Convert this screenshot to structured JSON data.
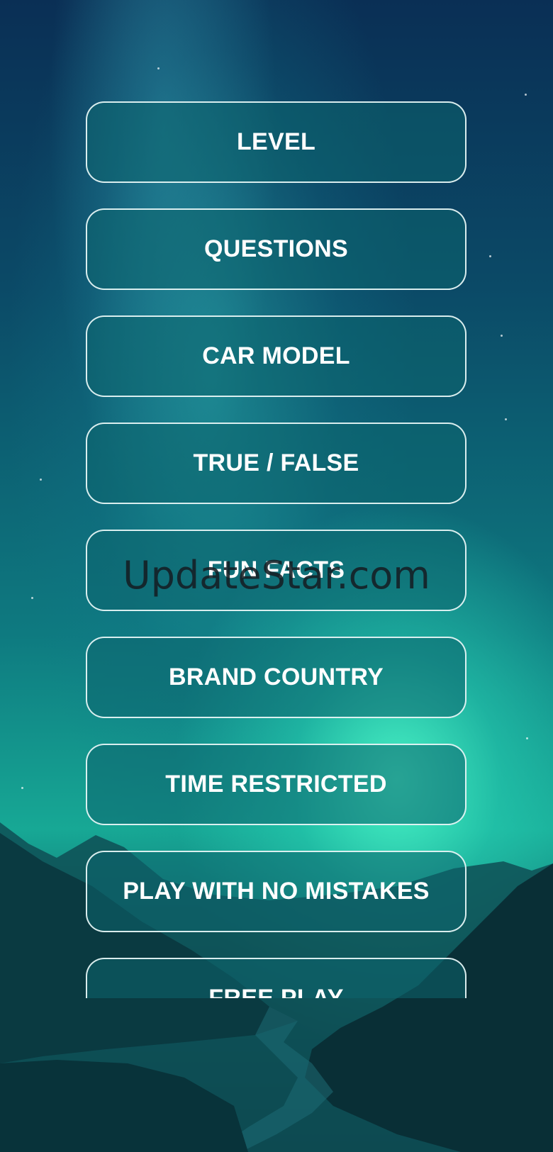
{
  "menu": {
    "items": [
      {
        "label": "LEVEL"
      },
      {
        "label": "QUESTIONS"
      },
      {
        "label": "CAR MODEL"
      },
      {
        "label": "TRUE / FALSE"
      },
      {
        "label": "FUN FACTS"
      },
      {
        "label": "BRAND COUNTRY"
      },
      {
        "label": "TIME RESTRICTED"
      },
      {
        "label": "PLAY WITH NO MISTAKES"
      },
      {
        "label": "FREE PLAY"
      }
    ]
  },
  "watermark": {
    "text": "UpdateStar.com"
  },
  "colors": {
    "sky_top": "#0a2f55",
    "aurora": "#50ffcd",
    "button_border": "#ebfafa",
    "button_text": "#ffffff"
  }
}
